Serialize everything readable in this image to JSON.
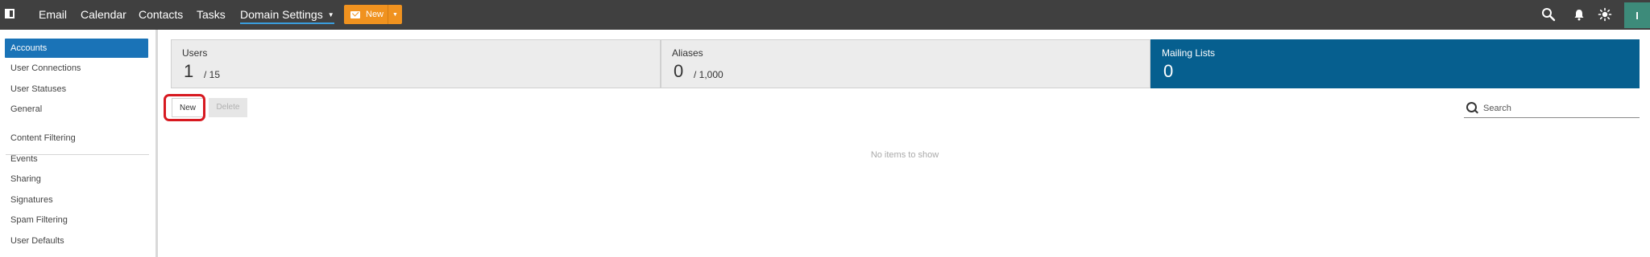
{
  "topbar": {
    "nav": [
      "Email",
      "Calendar",
      "Contacts",
      "Tasks",
      "Domain Settings"
    ],
    "new_label": "New",
    "avatar_initial": "I",
    "icons": [
      "panel-toggle-icon",
      "search-icon",
      "bell-icon",
      "sun-icon"
    ]
  },
  "sidebar": {
    "items": [
      "Accounts",
      "User Connections",
      "User Statuses",
      "General",
      "Content Filtering",
      "Events",
      "Sharing",
      "Signatures",
      "Spam Filtering",
      "User Defaults"
    ],
    "active": "Accounts"
  },
  "cards": [
    {
      "label": "Users",
      "count": "1",
      "max": "/ 15"
    },
    {
      "label": "Aliases",
      "count": "0",
      "max": "/ 1,000"
    },
    {
      "label": "Mailing Lists",
      "count": "0",
      "max": ""
    }
  ],
  "toolbar": {
    "new_label": "New",
    "delete_label": "Delete",
    "search_placeholder": "Search"
  },
  "list": {
    "empty_text": "No items to show"
  },
  "colors": {
    "topbar": "#404040",
    "accent": "#1a73b7",
    "new_button": "#f0921f",
    "selected_card": "#065f8f",
    "highlight": "#d71920",
    "avatar": "#3d8b7a"
  }
}
